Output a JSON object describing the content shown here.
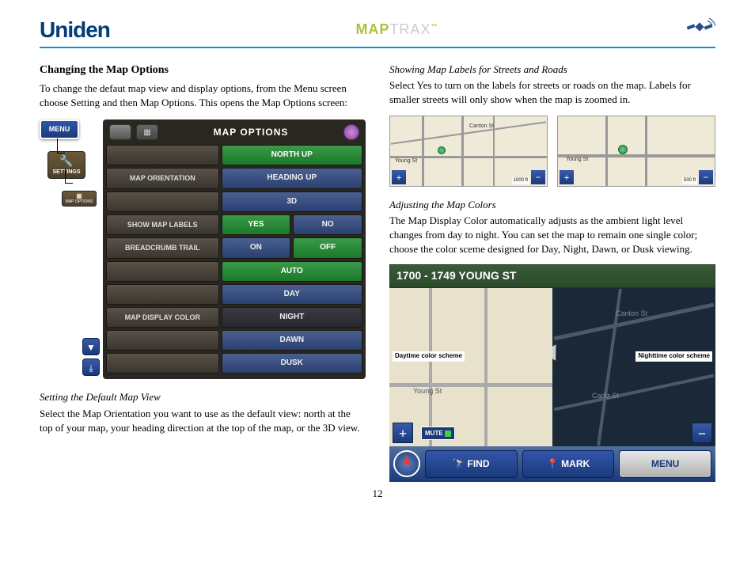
{
  "header": {
    "brand": "Uniden",
    "product_a": "MAP",
    "product_b": "TRAX"
  },
  "page_number": "12",
  "left": {
    "title": "Changing the Map Options",
    "intro": "To change the defaut map view and display options, from the Menu screen choose Setting and then Map Options. This opens the Map Options screen:",
    "menu_btn": "MENU",
    "settings_btn": "SETTINGS",
    "mapopt_btn": "MAP OPTIONS",
    "panel": {
      "title": "MAP OPTIONS",
      "rows": {
        "orientation_label": "MAP ORIENTATION",
        "orientation_opts": [
          "NORTH UP",
          "HEADING UP",
          "3D"
        ],
        "labels_label": "SHOW MAP LABELS",
        "labels_yes": "YES",
        "labels_no": "NO",
        "breadcrumb_label": "BREADCRUMB TRAIL",
        "breadcrumb_on": "ON",
        "breadcrumb_off": "OFF",
        "color_label": "MAP DISPLAY COLOR",
        "color_opts": [
          "AUTO",
          "DAY",
          "NIGHT",
          "DAWN",
          "DUSK"
        ]
      }
    },
    "sub1_title": "Setting the Default Map View",
    "sub1_body": "Select the Map Orientation you want to use as the default view: north at the top of your map, your heading direction at the top of the map, or the 3D view."
  },
  "right": {
    "sub1_title": "Showing Map Labels for Streets and Roads",
    "sub1_body": "Select Yes to turn on the labels for streets or roads on the map. Labels for smaller streets will only show when the map is zoomed in.",
    "thumb1": {
      "street1": "Young St",
      "street2": "Canton St",
      "scale": "1000 ft"
    },
    "thumb2": {
      "street1": "Young St",
      "scale": "500 ft"
    },
    "sub2_title": "Adjusting the Map Colors",
    "sub2_body": "The Map Display Color automatically adjusts as the ambient light level changes from day to night. You can set the map to remain one single color; choose the color sceme designed for Day, Night, Dawn, or Dusk viewing.",
    "bigmap": {
      "address": "1700 - 1749 YOUNG ST",
      "day_label": "Daytime color scheme",
      "night_label": "Nighttime color scheme",
      "mute": "MUTE",
      "find": "FIND",
      "mark": "MARK",
      "menu": "MENU",
      "streets": {
        "canton": "Canton St",
        "young": "Young St",
        "cadiz": "Cadiz St"
      }
    }
  }
}
